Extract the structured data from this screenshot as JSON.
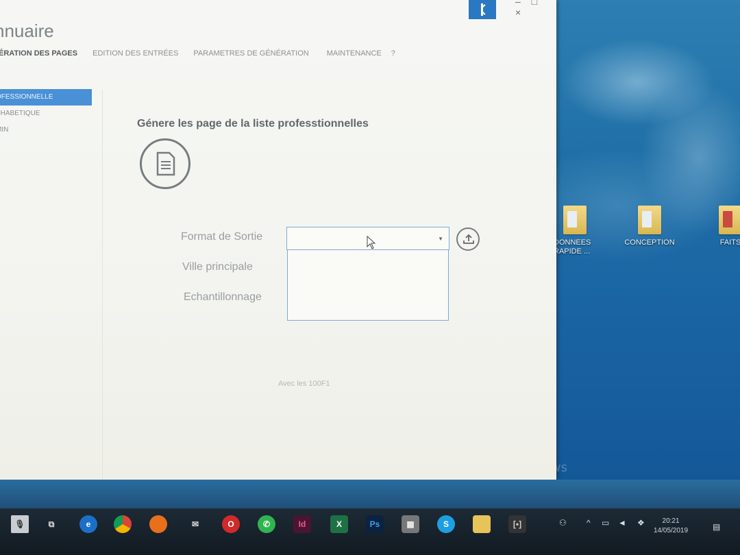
{
  "app": {
    "title": "nnuaire",
    "top_text": "",
    "logo_text": "",
    "window_controls": "– □ ×"
  },
  "menu": [
    {
      "label": "ÉRATION DES PAGES",
      "active": true
    },
    {
      "label": "EDITION DES ENTRÉES",
      "active": false
    },
    {
      "label": "PARAMETRES DE GÉNÉRATION",
      "active": false
    },
    {
      "label": "MAINTENANCE",
      "active": false
    },
    {
      "label": "?",
      "active": false
    }
  ],
  "sidebar": [
    {
      "label": "OFESSIONNELLE",
      "active": true
    },
    {
      "label": "PHABETIQUE",
      "active": false
    },
    {
      "label": "MIN",
      "active": false
    }
  ],
  "main": {
    "section_title": "Génere les page de la liste professtionnelles",
    "fields": {
      "format": "Format de Sortie",
      "ville": "Ville principale",
      "echantillonnage": "Echantillonnage"
    },
    "dropdown_value": "",
    "footnote": "Avec les 100F1"
  },
  "desktop": {
    "icons": [
      {
        "label": "DONNEES RAPIDE ..."
      },
      {
        "label": "CONCEPTION"
      },
      {
        "label": "FAITS"
      }
    ],
    "watermark": "ndows",
    "watermark_sub": "...",
    "corner_text": "..."
  },
  "taskbar": {
    "clock_time": "20:21",
    "clock_date": "14/05/2019"
  },
  "colors": {
    "accent": "#4a90d6",
    "dropdown_border": "#7ea8d4",
    "taskbar": "#121a22"
  }
}
